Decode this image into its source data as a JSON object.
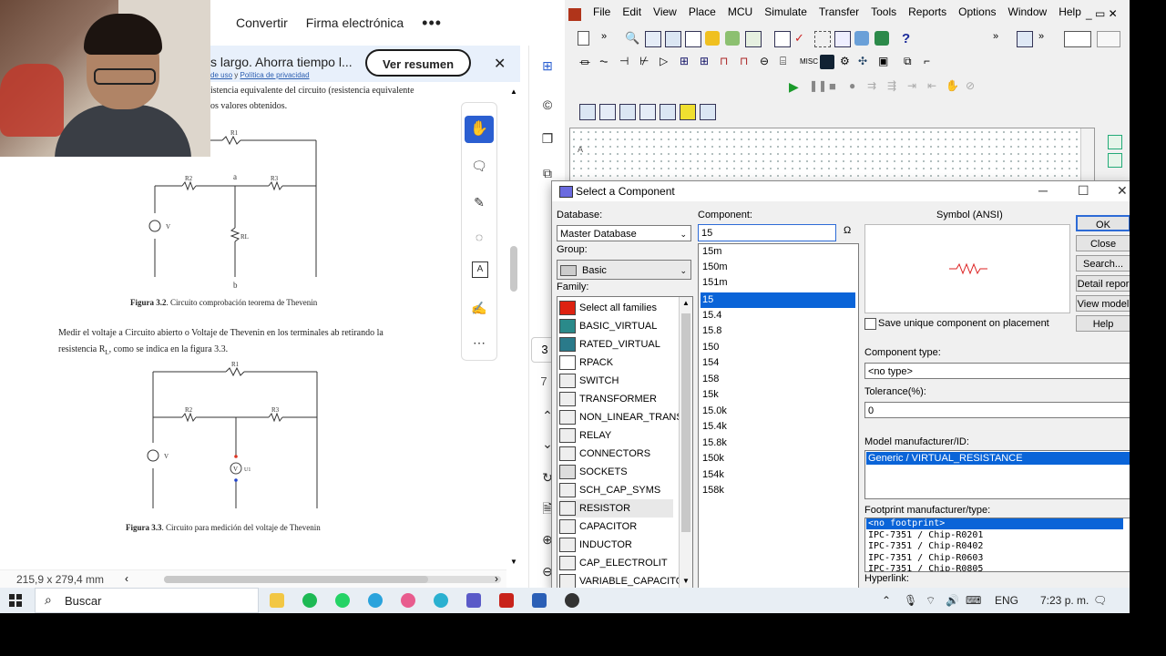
{
  "pdf": {
    "header_tabs": [
      "Convertir",
      "Firma electrónica"
    ],
    "more": "•••",
    "banner_text": "s largo. Ahorra tiempo l...",
    "banner_links_a": "de uso",
    "banner_links_sep": "y",
    "banner_links_b": "Política de privacidad",
    "ver_resumen": "Ver resumen",
    "close": "✕",
    "line1": "istencia equivalente del circuito (resistencia equivalente",
    "line2": "os valores obtenidos.",
    "fig1": {
      "r1": "R1",
      "r2": "R2",
      "r3": "R3",
      "a": "a",
      "b": "b",
      "v": "V",
      "rl": "RL"
    },
    "caption1_b": "Figura 3.2",
    "caption1": ". Circuito comprobación teorema de Thevenin",
    "para1": "Medir el voltaje a Circuito abierto o Voltaje de Thevenin en los terminales ab retirando la",
    "para2": "resistencia R",
    "para2_sub": "L",
    "para2_end": ", como se indica en la figura 3.3.",
    "fig2": {
      "r1": "R1",
      "r2": "R2",
      "r3": "R3",
      "v": "V",
      "vm": "V",
      "u": "U1"
    },
    "caption2_b": "Figura 3.3",
    "caption2": ". Circuito para medición del voltaje de Thevenin",
    "page_box": "3",
    "page_box2": "7",
    "dimensions": "215,9 x 279,4 mm"
  },
  "multisim": {
    "menu": [
      "File",
      "Edit",
      "View",
      "Place",
      "MCU",
      "Simulate",
      "Transfer",
      "Tools",
      "Reports",
      "Options",
      "Window",
      "Help"
    ],
    "canvas_marker": "A"
  },
  "dialog": {
    "title": "Select a Component",
    "database_label": "Database:",
    "database_value": "Master Database",
    "group_label": "Group:",
    "group_value": "Basic",
    "family_label": "Family:",
    "families": [
      "Select all families",
      "BASIC_VIRTUAL",
      "RATED_VIRTUAL",
      "RPACK",
      "SWITCH",
      "TRANSFORMER",
      "NON_LINEAR_TRANSF",
      "RELAY",
      "CONNECTORS",
      "SOCKETS",
      "SCH_CAP_SYMS",
      "RESISTOR",
      "CAPACITOR",
      "INDUCTOR",
      "CAP_ELECTROLIT",
      "VARIABLE_CAPACITOI"
    ],
    "component_label": "Component:",
    "component_value": "15",
    "components": [
      "15m",
      "150m",
      "151m",
      "15",
      "15.4",
      "15.8",
      "150",
      "154",
      "158",
      "15k",
      "15.0k",
      "15.4k",
      "15.8k",
      "150k",
      "154k",
      "158k"
    ],
    "selected_component": "15",
    "symbol_label": "Symbol (ANSI)",
    "save_unique": "Save unique component on placement",
    "component_type_label": "Component type:",
    "component_type_value": "<no type>",
    "tolerance_label": "Tolerance(%):",
    "tolerance_value": "0",
    "model_label": "Model manufacturer/ID:",
    "model_value": "Generic / VIRTUAL_RESISTANCE",
    "footprint_label": "Footprint manufacturer/type:",
    "footprints": [
      "<no footprint>",
      "IPC-7351 / Chip-R0201",
      "IPC-7351 / Chip-R0402",
      "IPC-7351 / Chip-R0603",
      "IPC-7351 / Chip-R0805"
    ],
    "hyperlink_label": "Hyperlink:",
    "buttons": {
      "ok": "OK",
      "close": "Close",
      "search": "Search...",
      "detail": "Detail repor",
      "view": "View model",
      "help": "Help"
    },
    "accent": "#0a64d8"
  },
  "taskbar": {
    "search": "Buscar",
    "lang": "ENG",
    "time": "7:23 p. m."
  }
}
